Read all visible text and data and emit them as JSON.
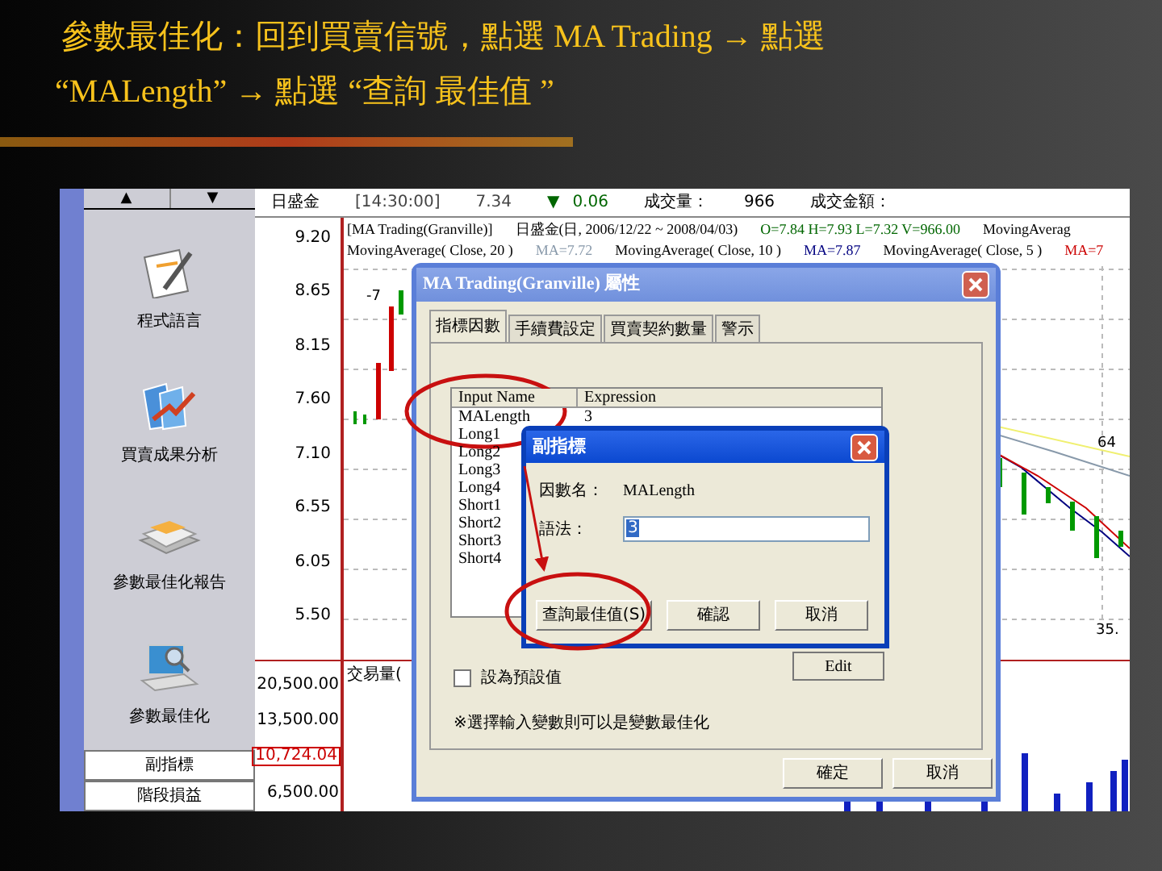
{
  "title": {
    "line1": "參數最佳化：回到買賣信號，點選 MA Trading → 點選",
    "line2": "“MALength” → 點選 “查詢 最佳值 ”"
  },
  "sidebar": {
    "scroll_up": "▲",
    "scroll_down": "▼",
    "items": [
      {
        "label": "程式語言",
        "kind": "notepad"
      },
      {
        "label": "買賣成果分析",
        "kind": "chart"
      },
      {
        "label": "參數最佳化報告",
        "kind": "papers"
      },
      {
        "label": "參數最佳化",
        "kind": "laptop"
      }
    ],
    "buttons": [
      "副指標",
      "階段損益"
    ]
  },
  "chart": {
    "header": {
      "symbol": "日盛金",
      "time": "[14:30:00]",
      "price": "7.34",
      "change_arrow": "▼",
      "change": "0.06",
      "volume_label": "成交量：",
      "volume": "966",
      "amount_label": "成交金額："
    },
    "legend_line1": [
      {
        "text": "[MA Trading(Granville)]",
        "color": "#000000"
      },
      {
        "text": "日盛金(日, 2006/12/22 ~ 2008/04/03)",
        "color": "#000000"
      },
      {
        "text": "O=7.84 H=7.93 L=7.32 V=966.00",
        "color": "#006600"
      },
      {
        "text": "MovingAverag",
        "color": "#000000"
      }
    ],
    "legend_line2": [
      {
        "text": "MovingAverage( Close, 20 )",
        "color": "#000000"
      },
      {
        "text": "MA=7.72",
        "color": "#8899aa"
      },
      {
        "text": "MovingAverage( Close, 10 )",
        "color": "#000000"
      },
      {
        "text": "MA=7.87",
        "color": "#000080"
      },
      {
        "text": "MovingAverage( Close, 5 )",
        "color": "#000000"
      },
      {
        "text": "MA=7",
        "color": "#cc0000"
      }
    ],
    "price_ticks": [
      "9.20",
      "8.65",
      "8.15",
      "7.60",
      "7.10",
      "6.55",
      "6.05",
      "5.50"
    ],
    "marks": [
      "-7",
      "64",
      "35."
    ],
    "volume_title": "交易量(",
    "volume_ticks": [
      {
        "label": "20,500.00",
        "highlighted": false
      },
      {
        "label": "13,500.00",
        "highlighted": false
      },
      {
        "label": "10,724.04",
        "highlighted": true
      },
      {
        "label": "6,500.00",
        "highlighted": false
      }
    ]
  },
  "dialog": {
    "title": "MA Trading(Granville) 屬性",
    "tabs": [
      {
        "label": "指標因數",
        "selected": true
      },
      {
        "label": "手續費設定",
        "selected": false
      },
      {
        "label": "買賣契約數量",
        "selected": false
      },
      {
        "label": "警示",
        "selected": false
      }
    ],
    "columns": [
      "Input Name",
      "Expression"
    ],
    "rows": [
      {
        "name": "MALength",
        "expression": "3"
      },
      {
        "name": "Long1"
      },
      {
        "name": "Long2"
      },
      {
        "name": "Long3"
      },
      {
        "name": "Long4"
      },
      {
        "name": "Short1"
      },
      {
        "name": "Short2"
      },
      {
        "name": "Short3"
      },
      {
        "name": "Short4"
      }
    ],
    "checkbox": {
      "label": "設為預設值",
      "checked": false
    },
    "edit_button": "Edit",
    "note": "※選擇輸入變數則可以是變數最佳化",
    "buttons": [
      "確定",
      "取消"
    ]
  },
  "subdialog": {
    "title": "副指標",
    "name_label": "因數名：",
    "name_value": "MALength",
    "expr_label": "語法：",
    "expr_value": "3",
    "buttons": [
      "查詢最佳值(S)",
      "確認",
      "取消"
    ]
  }
}
